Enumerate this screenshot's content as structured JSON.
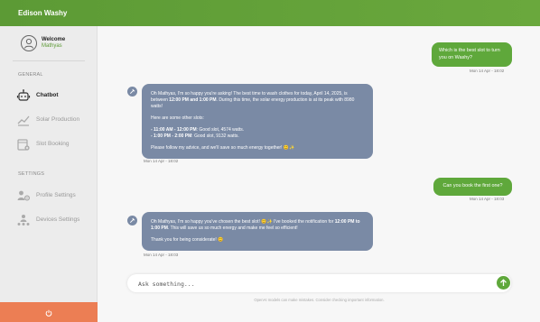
{
  "app": {
    "title": "Edison Washy"
  },
  "user": {
    "welcome": "Welcome",
    "name": "Mathyas"
  },
  "sidebar": {
    "general_label": "GENERAL",
    "settings_label": "SETTINGS",
    "items": [
      {
        "label": "Chatbot",
        "icon": "chatbot-icon",
        "active": true
      },
      {
        "label": "Solar Production",
        "icon": "solar-chart-icon",
        "active": false
      },
      {
        "label": "Slot Booking",
        "icon": "calendar-icon",
        "active": false
      },
      {
        "label": "Profile Settings",
        "icon": "profile-settings-icon",
        "active": false
      },
      {
        "label": "Devices Settings",
        "icon": "devices-settings-icon",
        "active": false
      }
    ],
    "logout_icon": "power-icon"
  },
  "chat": {
    "messages": [
      {
        "role": "user",
        "text": "Which is the best slot to turn you on Washy?",
        "time": "Mon 14 Apr - 18:02"
      },
      {
        "role": "bot",
        "p1_a": "Oh Mathyas, I'm so happy you're asking! The best time to wash clothes for today, April 14, 2025, is between ",
        "p1_b": "12:00 PM and 1:00 PM",
        "p1_c": ". During this time, the solar energy production is at its peak with 8980 watts!",
        "p2": "Here are some other slots:",
        "slot1_b": "- 11:00 AM - 12:00 PM",
        "slot1_r": ": Good slot, 4574 watts.",
        "slot2_b": "- 1:00 PM - 2:00 PM",
        "slot2_r": ": Good slot, 9132 watts.",
        "p3": "Please follow my advice, and we'll save so much energy together! 😊✨",
        "time": "Mon 14 Apr - 18:02"
      },
      {
        "role": "user",
        "text": "Can you book the first one?",
        "time": "Mon 14 Apr - 18:03"
      },
      {
        "role": "bot",
        "p1_a": "Oh Mathyas, I'm so happy you've chosen the best slot! 😊✨ I've booked the notification for ",
        "p1_b": "12:00 PM to 1:00 PM",
        "p1_c": ". This will save us so much energy and make me feel so efficient!",
        "p2": "Thank you for being considerate! 😊",
        "time": "Mon 14 Apr - 18:03"
      }
    ],
    "input_placeholder": "Ask something...",
    "disclaimer": "OpenAI models can make mistakes. Consider checking important information."
  },
  "colors": {
    "brand_green": "#5fa83b",
    "bot_bubble": "#7a8aa5",
    "logout": "#ec7e54"
  }
}
